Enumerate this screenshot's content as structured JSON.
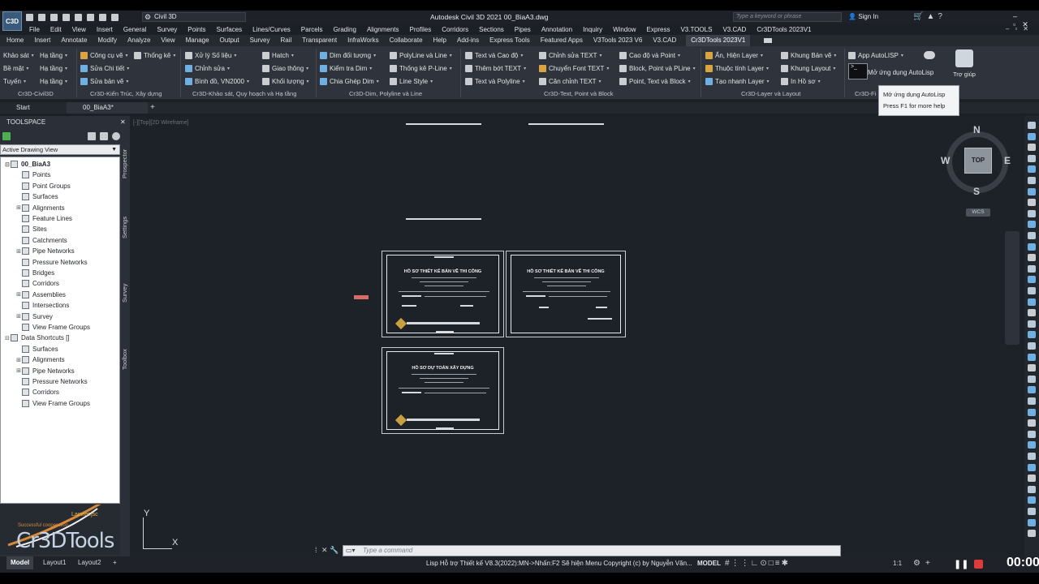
{
  "window": {
    "title": "Autodesk Civil 3D 2021   00_BiaA3.dwg",
    "app_logo": "C3D",
    "workspace": "Civil 3D",
    "search_placeholder": "Type a keyword or phrase",
    "signin": "Sign In"
  },
  "menu": [
    "File",
    "Edit",
    "View",
    "Insert",
    "General",
    "Survey",
    "Points",
    "Surfaces",
    "Lines/Curves",
    "Parcels",
    "Grading",
    "Alignments",
    "Profiles",
    "Corridors",
    "Sections",
    "Pipes",
    "Annotation",
    "Inquiry",
    "Window",
    "Express",
    "V3.TOOLS",
    "V3.CAD",
    "Cr3DTools 2023V1"
  ],
  "ribbon_tabs": [
    "Home",
    "Insert",
    "Annotate",
    "Modify",
    "Analyze",
    "View",
    "Manage",
    "Output",
    "Survey",
    "Rail",
    "Transparent",
    "InfraWorks",
    "Collaborate",
    "Help",
    "Add-ins",
    "Express Tools",
    "Featured Apps",
    "V3Tools 2023 V6",
    "V3.CAD",
    "Cr3DTools 2023V1"
  ],
  "ribbon_active_tab": "Cr3DTools 2023V1",
  "ribbon": {
    "civil3d": [
      "Khảo sát",
      "Bề mặt",
      "Tuyến",
      "Hạ tầng",
      "Hạ tầng",
      "Hạ tầng"
    ],
    "kientruc": [
      "Công cụ vẽ",
      "Sửa Chi tiết",
      "Sửa bản vẽ",
      "Thống kê"
    ],
    "khaosat": [
      "Xử lý Số liệu",
      "Chỉnh sửa",
      "Bình đồ, VN2000",
      "Hatch",
      "Giao thông",
      "Khối lượng"
    ],
    "dim": [
      "Dim đối tượng",
      "Kiểm tra Dim",
      "Chia Ghép Dim",
      "PolyLine và Line",
      "Thống kê P-Line",
      "Line Style"
    ],
    "text": [
      "Text và Cao độ",
      "Thêm bớt TEXT",
      "Text và Polyline",
      "Chỉnh sửa TEXT",
      "Chuyển Font TEXT",
      "Căn chỉnh TEXT",
      "Cao độ và Point",
      "Block, Point và PLine",
      "Point, Text và Block"
    ],
    "layer": [
      "Ẩn, Hiện Layer",
      "Thuộc tính Layer",
      "Tạo nhanh Layer",
      "Khung Bản vẽ",
      "Khung Layout",
      "In Hồ sơ"
    ],
    "autolisp": [
      "App AutoLISP",
      "Mở ứng dụng AutoLisp"
    ],
    "help": "Trợ giúp",
    "panel_labels": [
      "Cr3D-Civil3D",
      "Cr3D-Kiến Trúc, Xây dựng",
      "Cr3D-Khảo sát, Quy hoạch và Hạ tầng",
      "Cr3D-Dim, Polyline và Line",
      "Cr3D-Text, Point và Block",
      "Cr3D-Layer và Layout",
      "Cr3D-Fi"
    ]
  },
  "tooltip": {
    "title": "Mở ứng dụng AutoLisp",
    "hint": "Press F1 for more help"
  },
  "file_tabs": [
    "Start",
    "00_BiaA3*"
  ],
  "toolspace": {
    "title": "TOOLSPACE",
    "view": "Active Drawing View",
    "vtabs": [
      "Prospector",
      "Settings",
      "Survey",
      "Toolbox"
    ],
    "tree": [
      {
        "label": "00_BiaA3",
        "level": 0,
        "exp": "⊟",
        "bold": true
      },
      {
        "label": "Points",
        "level": 1,
        "exp": ""
      },
      {
        "label": "Point Groups",
        "level": 1,
        "exp": ""
      },
      {
        "label": "Surfaces",
        "level": 1,
        "exp": ""
      },
      {
        "label": "Alignments",
        "level": 1,
        "exp": "⊞"
      },
      {
        "label": "Feature Lines",
        "level": 1,
        "exp": ""
      },
      {
        "label": "Sites",
        "level": 1,
        "exp": ""
      },
      {
        "label": "Catchments",
        "level": 1,
        "exp": ""
      },
      {
        "label": "Pipe Networks",
        "level": 1,
        "exp": "⊞"
      },
      {
        "label": "Pressure Networks",
        "level": 1,
        "exp": ""
      },
      {
        "label": "Bridges",
        "level": 1,
        "exp": ""
      },
      {
        "label": "Corridors",
        "level": 1,
        "exp": ""
      },
      {
        "label": "Assemblies",
        "level": 1,
        "exp": "⊞"
      },
      {
        "label": "Intersections",
        "level": 1,
        "exp": ""
      },
      {
        "label": "Survey",
        "level": 1,
        "exp": "⊞"
      },
      {
        "label": "View Frame Groups",
        "level": 1,
        "exp": ""
      },
      {
        "label": "Data Shortcuts []",
        "level": 0,
        "exp": "⊟"
      },
      {
        "label": "Surfaces",
        "level": 1,
        "exp": ""
      },
      {
        "label": "Alignments",
        "level": 1,
        "exp": "⊞"
      },
      {
        "label": "Pipe Networks",
        "level": 1,
        "exp": "⊞"
      },
      {
        "label": "Pressure Networks",
        "level": 1,
        "exp": ""
      },
      {
        "label": "Corridors",
        "level": 1,
        "exp": ""
      },
      {
        "label": "View Frame Groups",
        "level": 1,
        "exp": ""
      }
    ]
  },
  "brand": {
    "name": "Cr3DTools",
    "company": "Lacviet.jsc",
    "slogan": "Successful cooperation"
  },
  "canvas": {
    "view_label": "[-][Top][2D Wireframe]",
    "sheets": [
      {
        "title": "HỒ SƠ THIẾT KẾ BẢN VẼ THI CÔNG"
      },
      {
        "title": "HỒ SƠ THIẾT KẾ BẢN VẼ THI CÔNG"
      },
      {
        "title": "HỒ SƠ DỰ TOÁN XÂY DỰNG"
      }
    ]
  },
  "viewcube": {
    "top": "TOP",
    "n": "N",
    "s": "S",
    "e": "E",
    "w": "W",
    "wcs": "WCS"
  },
  "ucs": {
    "x": "X",
    "y": "Y"
  },
  "command": {
    "placeholder": "Type a command",
    "prefix": "▭▾"
  },
  "layout_tabs": [
    "Model",
    "Layout1",
    "Layout2"
  ],
  "status": {
    "message": "Lisp Hỗ trợ Thiết kế V8.3(2022):MN->Nhấn:F2 Sẽ hiện Menu Copyright (c) by Nguyễn Văn...",
    "model": "MODEL",
    "scale": "1:1",
    "rec_time": "00:00"
  },
  "colors": {
    "accent": "#3a5a7c",
    "record": "#e03a3a"
  }
}
